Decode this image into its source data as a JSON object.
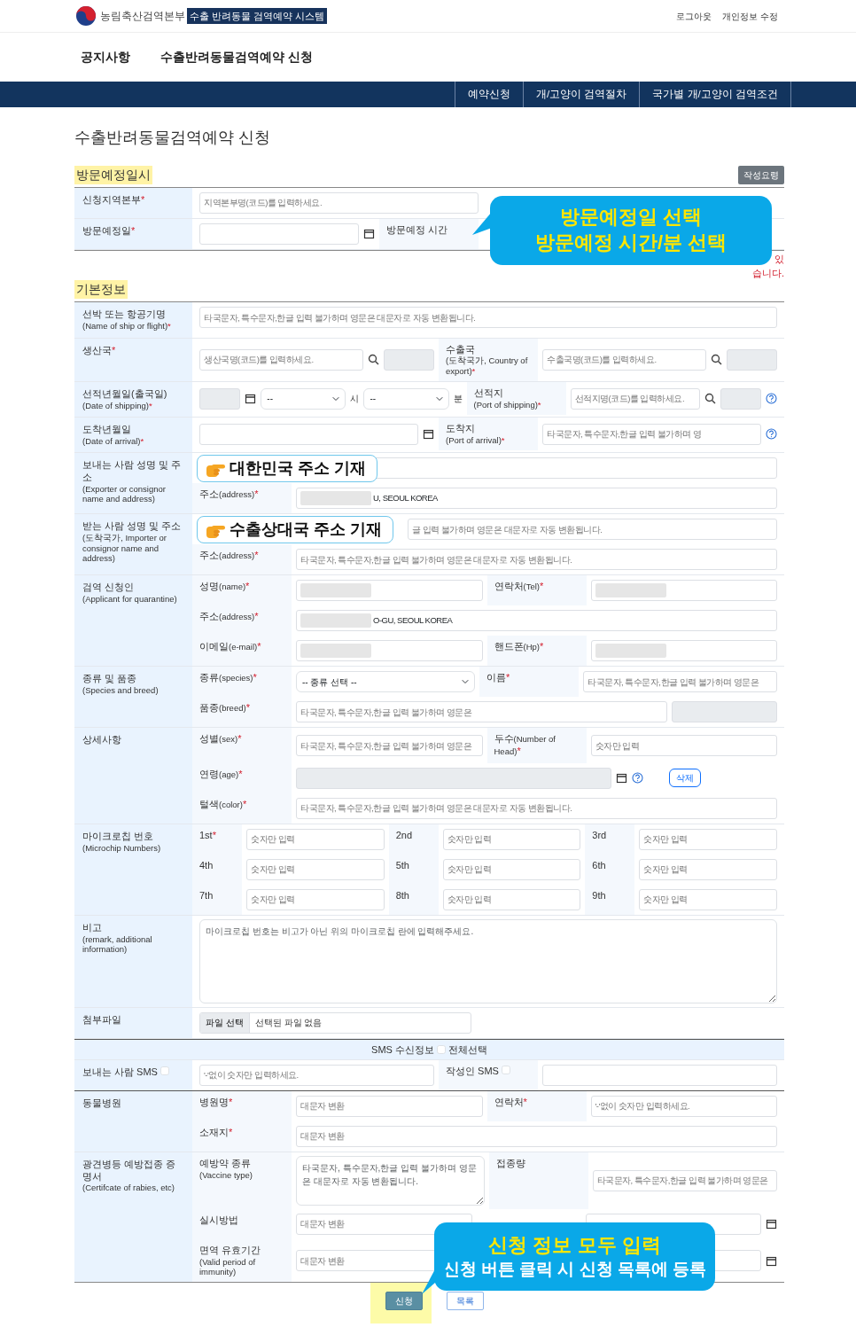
{
  "header": {
    "org": "농림축산검역본부",
    "system": "수출 반려동물 검역예약 시스템",
    "links": [
      "로그아웃",
      "개인정보 수정"
    ]
  },
  "nav": [
    "공지사항",
    "수출반려동물검역예약 신청"
  ],
  "subnav": [
    "예약신청",
    "개/고양이 검역절차",
    "국가별 개/고양이 검역조건"
  ],
  "page_title": "수출반려동물검역예약 신청",
  "sections": [
    {
      "title": "방문예정일시",
      "button": "작성요령",
      "note": "있 습니다.",
      "annotation": {
        "kind": "bubble",
        "lines": [
          {
            "text": "방문예정일 선택",
            "color": "#ffe600"
          },
          {
            "text": "방문예정 시간/분 선택",
            "color": "#ffe600"
          }
        ]
      },
      "groups": [
        {
          "kind": "plain",
          "head": {
            "text": "신청지역본부",
            "mark": "*"
          },
          "rows": [
            [
              {
                "kind": "input",
                "placeholder": "지역본부명(코드)를 입력하세요."
              }
            ]
          ]
        },
        {
          "kind": "plain",
          "head": {
            "text": "방문예정일",
            "mark": "*"
          },
          "rows": [
            [
              {
                "kind": "input"
              },
              {
                "kind": "calendar"
              },
              {
                "kind": "label",
                "text": "방문예정 시간"
              }
            ]
          ]
        }
      ]
    },
    {
      "title": "기본정보",
      "groups": [
        {
          "kind": "plain",
          "head": {
            "text": "선박 또는 항공기명",
            "sub": "(Name of ship or flight)",
            "mark": "*"
          },
          "rows": [
            [
              {
                "kind": "input",
                "placeholder": "타국문자, 특수문자,한글 입력 불가하며 영문은 대문자로 자동 변환됩니다."
              }
            ]
          ]
        },
        {
          "kind": "plain",
          "head": {
            "text": "생산국",
            "mark": "*"
          },
          "rows": [
            [
              {
                "kind": "input",
                "placeholder": "생산국명(코드)를 입력하세요."
              },
              {
                "kind": "search"
              },
              {
                "kind": "readonly"
              },
              {
                "kind": "label",
                "text": "수출국",
                "sub": "(도착국가, Country of export)",
                "mark": "*"
              },
              {
                "kind": "input",
                "placeholder": "수출국명(코드)를 입력하세요."
              },
              {
                "kind": "search"
              },
              {
                "kind": "readonly"
              }
            ]
          ]
        },
        {
          "kind": "plain",
          "head": {
            "text": "선적년월일(출국일)",
            "sub": "(Date of shipping)",
            "mark": "*"
          },
          "rows": [
            [
              {
                "kind": "readonly"
              },
              {
                "kind": "calendar"
              },
              {
                "kind": "select",
                "value": "--"
              },
              {
                "kind": "unit",
                "text": "시"
              },
              {
                "kind": "select",
                "value": "--"
              },
              {
                "kind": "unit",
                "text": "분"
              },
              {
                "kind": "label",
                "text": "선적지",
                "sub": "(Port of shipping)",
                "mark": "*"
              },
              {
                "kind": "input",
                "placeholder": "선적지명(코드)를 입력하세요."
              },
              {
                "kind": "search"
              },
              {
                "kind": "readonly"
              },
              {
                "kind": "help"
              }
            ]
          ]
        },
        {
          "kind": "plain",
          "head": {
            "text": "도착년월일",
            "sub": "(Date of arrival)",
            "mark": "*"
          },
          "rows": [
            [
              {
                "kind": "input"
              },
              {
                "kind": "calendar"
              },
              {
                "kind": "label",
                "text": "도착지",
                "sub": "(Port of arrival)",
                "mark": "*"
              },
              {
                "kind": "input",
                "placeholder": "타국문자, 특수문자,한글 입력 불가하며 영"
              },
              {
                "kind": "help"
              }
            ]
          ]
        },
        {
          "kind": "plain",
          "head": {
            "text": "보내는 사람 성명 및 주소",
            "sub": "(Exporter or consignor name and address)"
          },
          "annotation": {
            "kind": "tag",
            "text": "대한민국 주소 기재"
          },
          "rows": [
            [
              {
                "kind": "input"
              }
            ],
            [
              {
                "kind": "label",
                "text": "주소",
                "en": "(address)",
                "mark": "*"
              },
              {
                "kind": "input",
                "value": "U, SEOUL KOREA",
                "redacted": true
              }
            ]
          ]
        },
        {
          "kind": "plain",
          "head": {
            "text": "받는 사람 성명 및 주소",
            "sub": "(도착국가, Importer or consignor name and address)"
          },
          "annotation": {
            "kind": "tag",
            "text": "수출상대국 주소 기재"
          },
          "rows": [
            [
              {
                "kind": "gap"
              },
              {
                "kind": "input",
                "placeholder": "글 입력 불가하며 영문은 대문자로 자동 변환됩니다.",
                "covered": true
              }
            ],
            [
              {
                "kind": "label",
                "text": "주소",
                "en": "(address)",
                "mark": "*"
              },
              {
                "kind": "input",
                "placeholder": "타국문자, 특수문자,한글 입력 불가하며 영문은 대문자로 자동 변환됩니다."
              }
            ]
          ]
        },
        {
          "kind": "plain",
          "head": {
            "text": "검역 신청인",
            "sub": "(Applicant for quarantine)"
          },
          "rows": [
            [
              {
                "kind": "label",
                "text": "성명",
                "en": "(name)",
                "mark": "*"
              },
              {
                "kind": "input",
                "redacted": true
              },
              {
                "kind": "label",
                "text": "연락처",
                "en": "(Tel)",
                "mark": "*"
              },
              {
                "kind": "input",
                "redacted": true
              }
            ],
            [
              {
                "kind": "label",
                "text": "주소",
                "en": "(address)",
                "mark": "*"
              },
              {
                "kind": "input",
                "value": "O-GU, SEOUL KOREA",
                "redacted": true
              }
            ],
            [
              {
                "kind": "label",
                "text": "이메일",
                "en": "(e-mail)",
                "mark": "*"
              },
              {
                "kind": "input",
                "redacted": true
              },
              {
                "kind": "label",
                "text": "핸드폰",
                "en": "(Hp)",
                "mark": "*"
              },
              {
                "kind": "input",
                "redacted": true
              }
            ]
          ]
        },
        {
          "kind": "plain",
          "head": {
            "text": "종류 및 품종",
            "sub": "(Species and breed)"
          },
          "rows": [
            [
              {
                "kind": "label",
                "text": "종류",
                "en": "(species)",
                "mark": "*"
              },
              {
                "kind": "select",
                "value": "-- 종류 선택 --"
              },
              {
                "kind": "label",
                "text": "이름",
                "mark": "*"
              },
              {
                "kind": "input",
                "placeholder": "타국문자, 특수문자,한글 입력 불가하며 영문은"
              }
            ],
            [
              {
                "kind": "label",
                "text": "품종",
                "en": "(breed)",
                "mark": "*"
              },
              {
                "kind": "input",
                "placeholder": "타국문자, 특수문자,한글 입력 불가하며 영문은"
              },
              {
                "kind": "readonly"
              }
            ]
          ]
        },
        {
          "kind": "plain",
          "head": {
            "text": "상세사항"
          },
          "rows": [
            [
              {
                "kind": "label",
                "text": "성별",
                "en": "(sex)",
                "mark": "*"
              },
              {
                "kind": "input",
                "placeholder": "타국문자, 특수문자,한글 입력 불가하며 영문은"
              },
              {
                "kind": "label",
                "text": "두수",
                "en": "(Number of Head)",
                "mark": "*"
              },
              {
                "kind": "input",
                "placeholder": "숫자만 입력"
              }
            ],
            [
              {
                "kind": "label",
                "text": "연령",
                "en": "(age)",
                "mark": "*"
              },
              {
                "kind": "readonly"
              },
              {
                "kind": "calendar"
              },
              {
                "kind": "help"
              },
              {
                "kind": "button",
                "text": "삭제"
              }
            ],
            [
              {
                "kind": "label",
                "text": "털색",
                "en": "(color)",
                "mark": "*"
              },
              {
                "kind": "input",
                "placeholder": "타국문자, 특수문자,한글 입력 불가하며 영문은 대문자로 자동 변환됩니다."
              }
            ]
          ]
        },
        {
          "kind": "microchip",
          "head": {
            "text": "마이크로칩 번호",
            "sub": "(Microchip Numbers)"
          },
          "rows": [
            [
              {
                "kind": "label",
                "text": "1st",
                "mark": "*"
              },
              {
                "kind": "input",
                "placeholder": "숫자만 입력"
              },
              {
                "kind": "label",
                "text": "2nd"
              },
              {
                "kind": "input",
                "placeholder": "숫자만 입력"
              },
              {
                "kind": "label",
                "text": "3rd"
              },
              {
                "kind": "input",
                "placeholder": "숫자만 입력"
              }
            ],
            [
              {
                "kind": "label",
                "text": "4th"
              },
              {
                "kind": "input",
                "placeholder": "숫자만 입력"
              },
              {
                "kind": "label",
                "text": "5th"
              },
              {
                "kind": "input",
                "placeholder": "숫자만 입력"
              },
              {
                "kind": "label",
                "text": "6th"
              },
              {
                "kind": "input",
                "placeholder": "숫자만 입력"
              }
            ],
            [
              {
                "kind": "label",
                "text": "7th"
              },
              {
                "kind": "input",
                "placeholder": "숫자만 입력"
              },
              {
                "kind": "label",
                "text": "8th"
              },
              {
                "kind": "input",
                "placeholder": "숫자만 입력"
              },
              {
                "kind": "label",
                "text": "9th"
              },
              {
                "kind": "input",
                "placeholder": "숫자만 입력"
              }
            ]
          ]
        },
        {
          "kind": "plain",
          "head": {
            "text": "비고",
            "sub": "(remark, additional information)"
          },
          "rows": [
            [
              {
                "kind": "textarea",
                "placeholder": "마이크로칩 번호는 비고가 아닌 위의 마이크로칩 란에 입력해주세요."
              }
            ]
          ]
        },
        {
          "kind": "plain",
          "head": {
            "text": "첨부파일"
          },
          "rows": [
            [
              {
                "kind": "file",
                "button": "파일 선택",
                "status": "선택된 파일 없음"
              }
            ]
          ]
        },
        {
          "kind": "banner",
          "text": "SMS 수신정보",
          "checkbox_label": "전체선택",
          "checked": false
        },
        {
          "kind": "sms",
          "head": {
            "text": "보내는 사람 SMS",
            "checked": false
          },
          "rows": [
            [
              {
                "kind": "input",
                "placeholder": "'-'없이 숫자만 입력하세요."
              },
              {
                "kind": "label",
                "text": "작성인 SMS",
                "checked": false
              },
              {
                "kind": "input"
              }
            ]
          ]
        },
        {
          "kind": "plain",
          "head": {
            "text": "동물병원"
          },
          "rows": [
            [
              {
                "kind": "label",
                "text": "병원명",
                "mark": "*"
              },
              {
                "kind": "input",
                "placeholder": "대문자 변환"
              },
              {
                "kind": "label",
                "text": "연락처",
                "mark": "*"
              },
              {
                "kind": "input",
                "placeholder": "'-'없이 숫자만 입력하세요."
              }
            ],
            [
              {
                "kind": "label",
                "text": "소재지",
                "mark": "*"
              },
              {
                "kind": "input",
                "placeholder": "대문자 변환"
              }
            ]
          ]
        },
        {
          "kind": "plain",
          "head": {
            "text": "광견병등 예방접종 증명서",
            "sub": "(Certifcate of rabies, etc)"
          },
          "annotation": {
            "kind": "bubble",
            "lines": [
              {
                "text": "신청 정보 모두 입력",
                "color": "#ffe600"
              },
              {
                "text": "신청 버튼 클릭 시 신청 목록에 등록",
                "color": "#ffffff"
              }
            ]
          },
          "rows": [
            [
              {
                "kind": "label",
                "text": "예방약 종류",
                "sub": "(Vaccine type)"
              },
              {
                "kind": "textarea",
                "placeholder": "타국문자, 특수문자,한글 입력 불가하며 영문은 대문자로 자동 변환됩니다."
              },
              {
                "kind": "label",
                "text": "접종량"
              },
              {
                "kind": "input",
                "placeholder": "타국문자, 특수문자,한글 입력 불가하며 영문은"
              }
            ],
            [
              {
                "kind": "label",
                "text": "실시방법"
              },
              {
                "kind": "input",
                "placeholder": "대문자 변환"
              },
              {
                "kind": "gap"
              },
              {
                "kind": "input"
              },
              {
                "kind": "calendar"
              }
            ],
            [
              {
                "kind": "label",
                "text": "면역 유효기간",
                "sub": "(Valid period of immunity)"
              },
              {
                "kind": "input",
                "placeholder": "대문자 변환"
              },
              {
                "kind": "gap"
              },
              {
                "kind": "input"
              },
              {
                "kind": "calendar"
              }
            ]
          ]
        }
      ]
    }
  ],
  "actions": [
    {
      "text": "신청",
      "kind": "primary",
      "highlighted": true
    },
    {
      "text": "목록",
      "kind": "outline",
      "highlighted": false
    }
  ]
}
